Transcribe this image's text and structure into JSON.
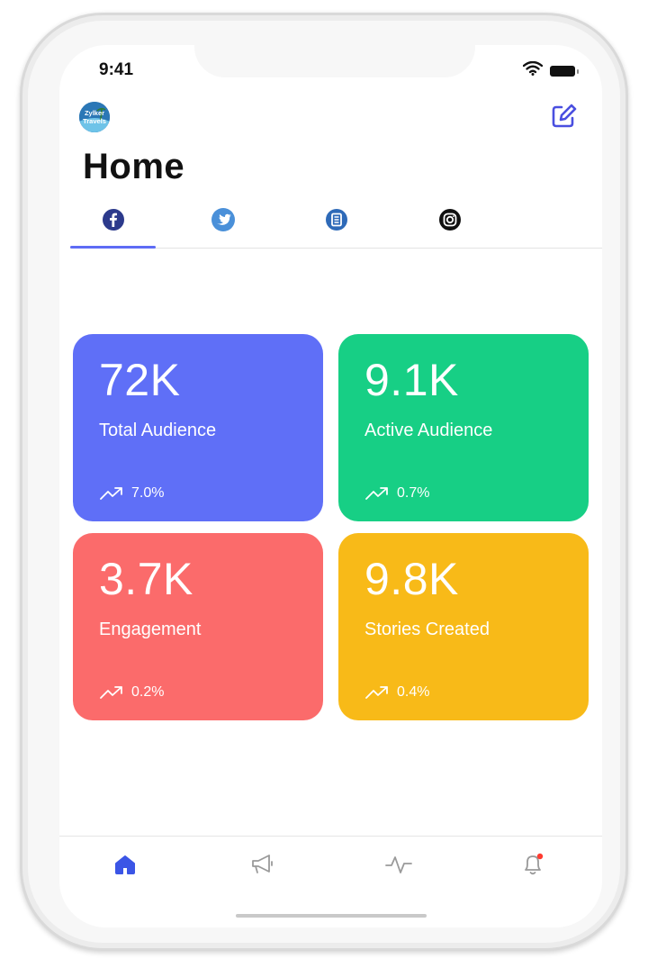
{
  "status_bar": {
    "time": "9:41"
  },
  "header": {
    "logo_text_line1": "Zylker",
    "logo_text_line2": "Travels",
    "title": "Home"
  },
  "tabs": [
    {
      "name": "facebook",
      "icon": "facebook-icon",
      "selected": true
    },
    {
      "name": "twitter",
      "icon": "twitter-icon",
      "selected": false
    },
    {
      "name": "page",
      "icon": "page-icon",
      "selected": false
    },
    {
      "name": "instagram",
      "icon": "instagram-icon",
      "selected": false
    }
  ],
  "cards": [
    {
      "value": "72K",
      "label": "Total Audience",
      "trend": "7.0%",
      "color": "#5f6ff7"
    },
    {
      "value": "9.1K",
      "label": "Active Audience",
      "trend": "0.7%",
      "color": "#17cf85"
    },
    {
      "value": "3.7K",
      "label": "Engagement",
      "trend": "0.2%",
      "color": "#fb6b6b"
    },
    {
      "value": "9.8K",
      "label": "Stories Created",
      "trend": "0.4%",
      "color": "#f8ba18"
    }
  ],
  "bottom_nav": [
    {
      "icon": "home-icon",
      "selected": true
    },
    {
      "icon": "megaphone-icon",
      "selected": false
    },
    {
      "icon": "activity-icon",
      "selected": false
    },
    {
      "icon": "bell-icon",
      "selected": false
    }
  ],
  "colors": {
    "accent": "#3b55e6",
    "tab_underline": "#5e6cf5",
    "icon_gray": "#9a9a9a",
    "notification_dot": "#ff3b30"
  }
}
